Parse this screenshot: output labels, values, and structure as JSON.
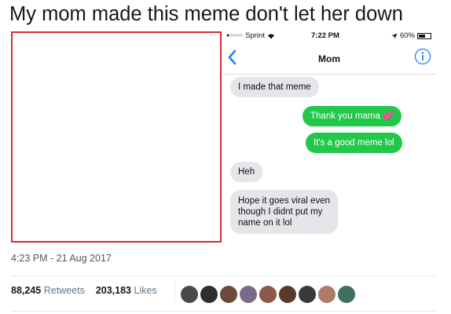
{
  "headline": "My mom made this meme don't let her down",
  "phone": {
    "status": {
      "carrier": "Sprint",
      "signal_dots": "●○○○○",
      "time": "7:22 PM",
      "battery": "60%",
      "battery_level": 0.6
    },
    "contact": "Mom",
    "messages": [
      {
        "from": "them",
        "text": "I made that meme"
      },
      {
        "from": "me",
        "text": "Thank you mama 💕"
      },
      {
        "from": "me",
        "text": "It's a good meme lol"
      },
      {
        "from": "them",
        "text": "Heh"
      },
      {
        "from": "them",
        "lines": [
          "Hope it goes viral even",
          "though I didnt put my",
          "name on it lol"
        ]
      }
    ]
  },
  "tweet": {
    "timestamp": "4:23 PM - 21 Aug 2017",
    "retweets_count": "88,245",
    "retweets_label": "Retweets",
    "likes_count": "203,183",
    "likes_label": "Likes"
  },
  "colors": {
    "frame_border": "#d22f2f",
    "incoming_bubble": "#e5e5ea",
    "outgoing_bubble": "#22c84a",
    "ios_blue": "#1a82fb"
  },
  "avatars": [
    {
      "name": "avatar-1",
      "color": "#4a4a4a"
    },
    {
      "name": "avatar-2",
      "color": "#2e2e2e"
    },
    {
      "name": "avatar-3",
      "color": "#6b4a3a"
    },
    {
      "name": "avatar-4",
      "color": "#7a6a8a"
    },
    {
      "name": "avatar-5",
      "color": "#8a5a4a"
    },
    {
      "name": "avatar-6",
      "color": "#5a3a2a"
    },
    {
      "name": "avatar-7",
      "color": "#3a3a3a"
    },
    {
      "name": "avatar-8",
      "color": "#b07a6a"
    },
    {
      "name": "avatar-9",
      "color": "#3f6f5f"
    }
  ]
}
